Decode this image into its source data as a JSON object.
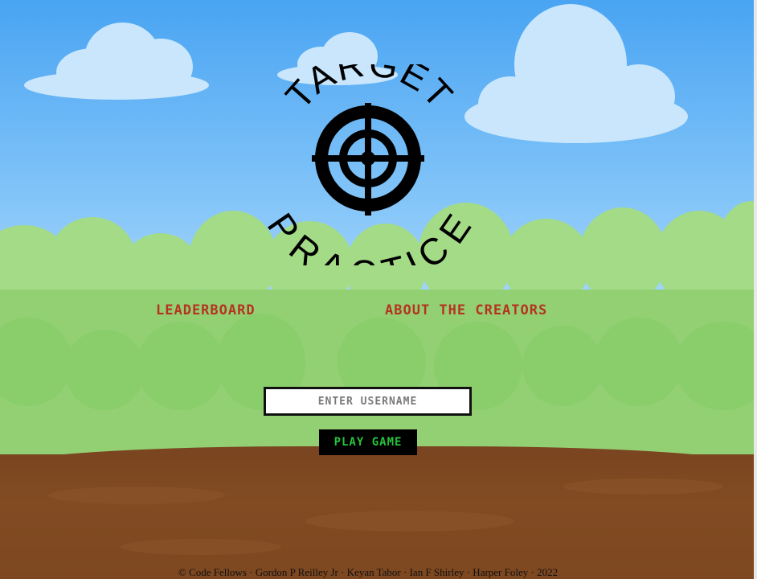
{
  "logo": {
    "top_word": "TARGET",
    "bottom_word": "PRACTICE",
    "icon": "crosshair-target-icon"
  },
  "nav": {
    "leaderboard_label": "LEADERBOARD",
    "about_label": "ABOUT THE CREATORS"
  },
  "form": {
    "username_placeholder": "ENTER USERNAME",
    "play_label": "PLAY GAME"
  },
  "footer": {
    "text": "© Code Fellows · Gordon P Reilley Jr · Keyan Tabor · Ian F Shirley · Harper Foley · 2022"
  },
  "colors": {
    "sky": "#49a4f2",
    "grass": "#93d073",
    "dirt": "#7d4720",
    "nav_text": "#b5341f",
    "play_text": "#27c23a"
  }
}
